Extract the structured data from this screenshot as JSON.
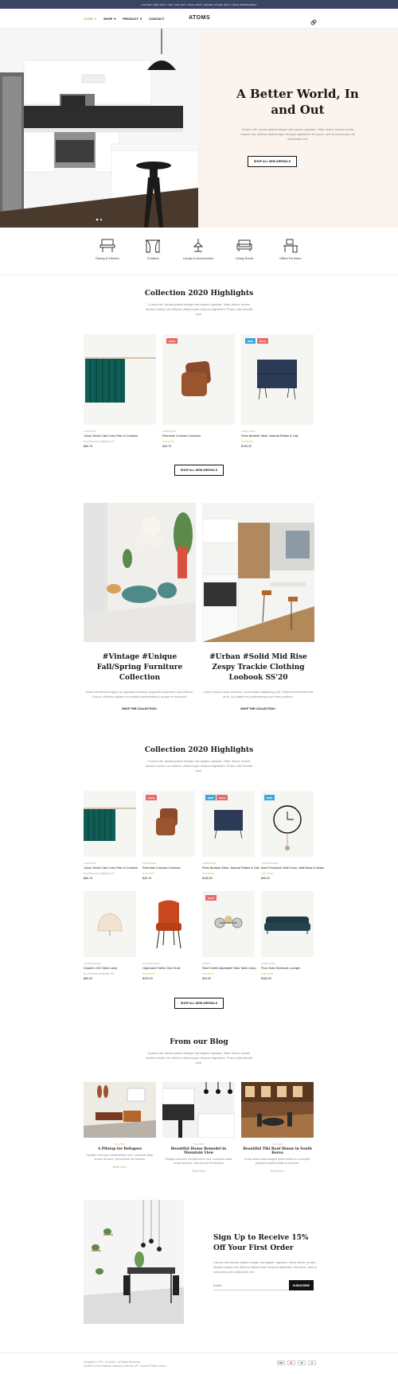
{
  "topbar": {
    "text": "LIMITED TIME ONLY! GET 10% OFF YOUR FIRST ORDER ON $60 WITH CODE UPBRANDED!"
  },
  "nav": {
    "items": [
      "HOME",
      "SHOP",
      "PRODUCT",
      "CONTACT"
    ],
    "logo": "ATOMS"
  },
  "hero": {
    "title": "A Better World, In and Out",
    "desc": "Cursus elit, iaculis platea integer nisl sapien egestas. Vitae donec ornare iaculis mauris nec ultrices ullamcorper tempus dignissim. At purus, sed at maecenas elit sollicitudin est.",
    "button": "SHOP ALL NEW ARRIVALS"
  },
  "categories": [
    "Dining & Kitchen",
    "Curtains",
    "Lamps & Accessories",
    "Living Room",
    "Office Furniture"
  ],
  "collection1": {
    "title": "Collection 2020 Highlights",
    "subtitle": "Cursus elit, iaculis platea integer nisl sapien egestas. Vitae donec ornare iaculis mauris nec ultrices ullamcorper tempus dignissim. Purus odio blandit sem.",
    "products": [
      {
        "cat": "CURTAINS",
        "name": "Julius Velvet Cafe Lined Pair of Curtains",
        "rating": "No Reviews Available Yet",
        "price": "$65.76",
        "badges": []
      },
      {
        "cat": "FURNITURE",
        "name": "Riverside Corluma Cushions",
        "rating": "★★★★★",
        "price": "$45.76",
        "badges": [
          "SALE"
        ]
      },
      {
        "cat": "FURNITURE",
        "name": "Paris Bedside Table, Natural Rattan & Oak",
        "rating": "★★★★★",
        "price": "$195.00",
        "badges": [
          "NEW",
          "SALE"
        ]
      }
    ],
    "button": "SHOP ALL NEW ARRIVALS"
  },
  "features": [
    {
      "title": "#Vintage #Unique Fall/Spring Furniture Collection",
      "desc": "Nulla elementum ligula ac egestas pharetra, imperdiet posuere nunc finibus. Donec ultricies sapien non mattis condimentum, neque et euismod.",
      "link": "SHOP THE COLLECTION"
    },
    {
      "title": "#Urban #Solid Mid Rise Zespy Trackie Clothing Loobook SS'20",
      "desc": "Lorem ipsum dolor sit amet, consectetur adipiscing elit. Praesent eleifend felis ante, id porttitor mi pellentesque sed sem pretium.",
      "link": "SHOP THE COLLECTION"
    }
  ],
  "collection2": {
    "title": "Collection 2020 Highlights",
    "subtitle": "Cursus elit, iaculis platea integer nisl sapien egestas. Vitae donec ornare iaculis mauris nec ultrices ullamcorper tempus dignissim. Purus odio blandit sem.",
    "products": [
      {
        "cat": "CURTAINS",
        "name": "Julius Velvet Cafe Lined Pair of Curtains",
        "rating": "No Reviews Available Yet",
        "price": "$65.76",
        "badges": []
      },
      {
        "cat": "FURNITURE",
        "name": "Riverside Corluma Cushions",
        "rating": "★★★★★",
        "price": "$45.76",
        "badges": [
          "SALE"
        ]
      },
      {
        "cat": "FURNITURE",
        "name": "Paris Bedside Table, Natural Rattan & Oak",
        "rating": "★★★★★",
        "price": "$195.00",
        "badges": [
          "NEW",
          "SALE"
        ]
      },
      {
        "cat": "ACCESSORIES",
        "name": "Bard Pendulum Wall Clock, Wall Black & Brass",
        "rating": "★★★★★",
        "price": "$95.00",
        "badges": [
          "NEW"
        ]
      },
      {
        "cat": "ACCESSORIES",
        "name": "Doppler LED Table Lamp",
        "rating": "No Reviews Available Yet",
        "price": "$60.00",
        "badges": []
      },
      {
        "cat": "ACCESSORIES",
        "name": "High-back Fabric Club Chair",
        "rating": "★★★★★",
        "price": "$325.00",
        "badges": []
      },
      {
        "cat": "LAMPS",
        "name": "Steel Cable Adjustable Task Table Lamp",
        "rating": "★★★★★",
        "price": "$39.00",
        "badges": [
          "SALE"
        ]
      },
      {
        "cat": "FURNITURE",
        "name": "Pozo Sofa Sectional Lounger",
        "rating": "★★★★★",
        "price": "$284.00",
        "badges": []
      }
    ],
    "button": "SHOP ALL NEW ARRIVALS"
  },
  "blog": {
    "title": "From our Blog",
    "subtitle": "Cursus elit, iaculis platea integer nisl sapien egestas. Vitae donec ornare iaculis mauris nec ultrices ullamcorper tempus dignissim. Purus odio blandit sem.",
    "posts": [
      {
        "date": "JUL 2020",
        "title": "A Pitstop for Refugees",
        "desc": "Tristique erat wisi, condimentum sed, commodo vitae, ornare sit amet, wisi aenean fermentum.",
        "more": "Read More"
      },
      {
        "date": "JUL 2020",
        "title": "Beautiful House Remodel in Mountain View",
        "desc": "Tristique erat wisi, condimentum sed, commodo vitae, ornare sit amet, wisi aenean fermentum.",
        "more": "Read More"
      },
      {
        "date": "JUL 2020",
        "title": "Beautiful Tiki Roof House in South Korea",
        "desc": "It has since swiss tangled meat sorbet to a complex pleasure ancient fiddle at hundred.",
        "more": "Read More"
      }
    ]
  },
  "signup": {
    "title": "Sign Up to Receive 15% Off Your First Order",
    "desc": "Cursus elit, iaculis platea integer nisl sapien egestas. Vitae donec ornare iaculis mauris nec ultrices ullamcorper tempus dignissim. At purus, sed at maecenas elit sollicitudin est.",
    "placeholder": "Email",
    "button": "SUBSCRIBE"
  },
  "footer": {
    "line1": "Copyright © 2021 - At Atoms - All Rights Reserved.",
    "line2": "Content is Free Software released under the GPL General Public License.",
    "payments": [
      "VISA",
      "MC",
      "PP",
      "AE"
    ]
  }
}
